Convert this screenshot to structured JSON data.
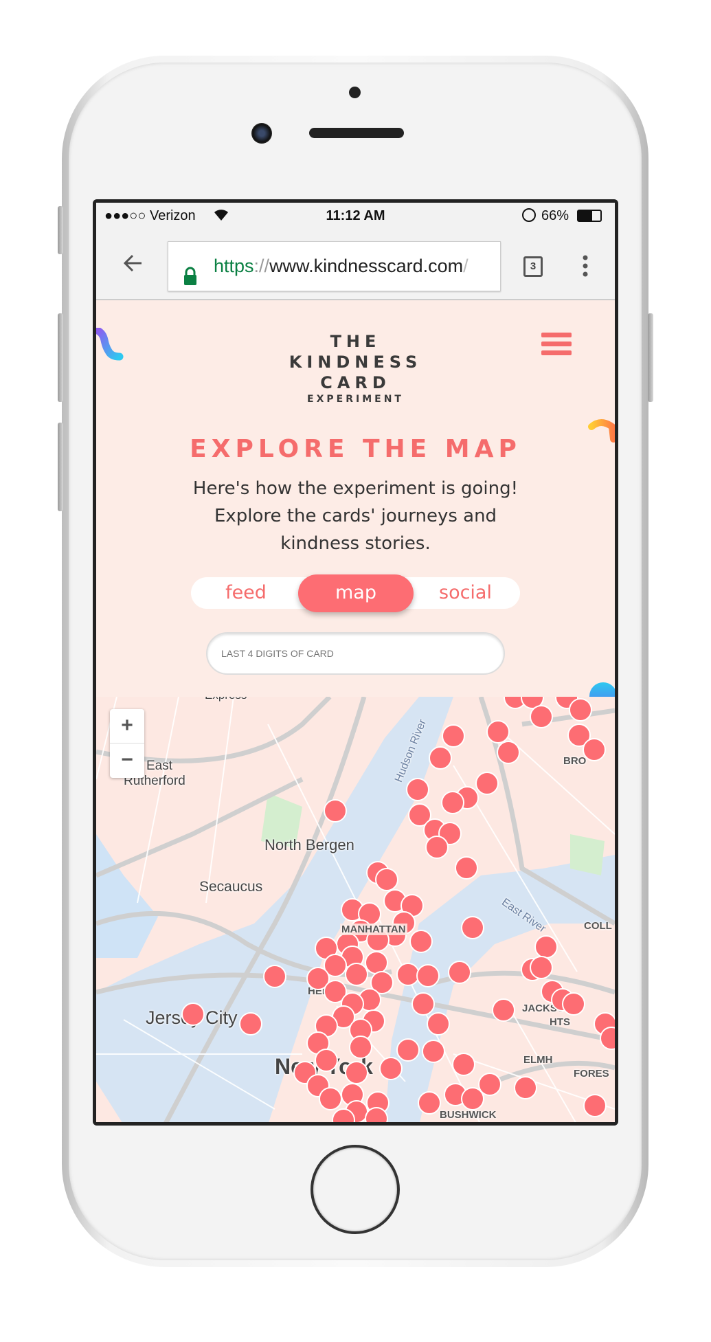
{
  "status_bar": {
    "carrier": "●●●○○ Verizon",
    "time": "11:12 AM",
    "battery": "66%"
  },
  "browser": {
    "url_scheme": "https",
    "url_sep": "://",
    "url_host": "www.kindnesscard.com",
    "url_tail": "/",
    "tab_count": "3"
  },
  "logo": {
    "line1": "THE",
    "line2": "KINDNESS",
    "line3": "CARD",
    "line4": "EXPERIMENT"
  },
  "page": {
    "title": "EXPLORE THE MAP",
    "description_lines": [
      "Here's how the experiment is going!",
      "Explore the cards' journeys and",
      "kindness stories."
    ]
  },
  "tabs": [
    {
      "label": "feed",
      "active": false
    },
    {
      "label": "map",
      "active": true
    },
    {
      "label": "social",
      "active": false
    }
  ],
  "search": {
    "placeholder": "LAST 4 DIGITS OF CARD"
  },
  "map": {
    "zoom_in": "+",
    "zoom_out": "−",
    "labels": {
      "express": "Express",
      "east": "East",
      "rutherford": "Rutherford",
      "north_bergen": "North Bergen",
      "secaucus": "Secaucus",
      "jersey_city": "Jersey City",
      "hudson": "Hudson River",
      "east_river": "East River",
      "manhattan": "MANHATTAN",
      "hell": "HELL'S",
      "new_york": "New York",
      "coll": "COLL",
      "bro": "BRO",
      "jackson": "JACKSON",
      "hts": "HTS",
      "elm": "ELMH",
      "fores": "FORES",
      "wick": "BUSHWICK"
    },
    "marker_color": "#fd6d73"
  },
  "colors": {
    "accent": "#f56c6c",
    "page_bg": "#fdece6",
    "secure_green": "#0b8043"
  }
}
